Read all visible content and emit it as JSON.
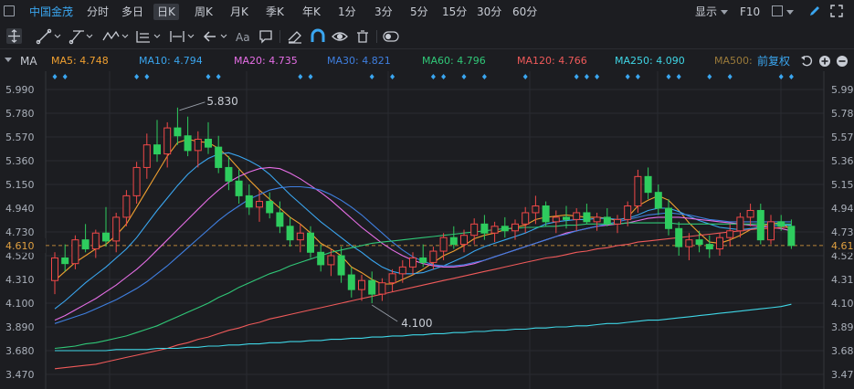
{
  "toolbar": {
    "stock_name": "中国金茂",
    "periods": [
      "分时",
      "多日",
      "日K",
      "周K",
      "月K",
      "季K",
      "年K",
      "1分",
      "3分",
      "5分",
      "15分",
      "30分",
      "60分"
    ],
    "selected_period": "日K",
    "display_label": "显示",
    "f10_label": "F10"
  },
  "drawing_tools": {
    "icons": [
      "crosshair-icon",
      "line-tool-icon",
      "channel-tool-icon",
      "wave-tool-icon",
      "fib-tool-icon",
      "measure-tool-icon",
      "arrow-tool-icon",
      "text-tool-icon",
      "note-icon",
      "eraser-icon",
      "magnet-icon",
      "eye-icon",
      "trash-icon",
      "toggle-icon"
    ]
  },
  "indicators": {
    "main_label": "MA",
    "items": [
      {
        "label": "MA5: 4.748",
        "color": "#f0a030"
      },
      {
        "label": "MA10: 4.794",
        "color": "#3aa6f0"
      },
      {
        "label": "MA20: 4.735",
        "color": "#e66ee6"
      },
      {
        "label": "MA30: 4.821",
        "color": "#3f7fe0"
      },
      {
        "label": "MA60: 4.796",
        "color": "#30c878"
      },
      {
        "label": "MA120: 4.766",
        "color": "#f05a5a"
      },
      {
        "label": "MA250: 4.090",
        "color": "#3fd6e6"
      },
      {
        "label": "MA500:",
        "color": "#9a7a3a"
      }
    ],
    "adjust_label": "前复权"
  },
  "chart_data": {
    "type": "candlestick",
    "y_ticks": [
      "5.990",
      "5.780",
      "5.570",
      "5.360",
      "5.150",
      "4.940",
      "4.730",
      "4.520",
      "4.310",
      "4.100",
      "3.890",
      "3.680",
      "3.470"
    ],
    "ylim": [
      3.47,
      5.99
    ],
    "current_price": "4.610",
    "annotations": {
      "high": "5.830",
      "low": "4.100"
    },
    "up_color": "#f04848",
    "down_color": "#2ecc5e",
    "candles": [
      [
        4.3,
        4.55,
        4.18,
        4.5
      ],
      [
        4.5,
        4.62,
        4.38,
        4.45
      ],
      [
        4.45,
        4.7,
        4.4,
        4.66
      ],
      [
        4.66,
        4.8,
        4.55,
        4.58
      ],
      [
        4.58,
        4.75,
        4.5,
        4.72
      ],
      [
        4.72,
        4.95,
        4.6,
        4.65
      ],
      [
        4.65,
        4.9,
        4.55,
        4.86
      ],
      [
        4.86,
        5.1,
        4.78,
        5.05
      ],
      [
        5.05,
        5.35,
        4.98,
        5.3
      ],
      [
        5.3,
        5.6,
        5.2,
        5.5
      ],
      [
        5.5,
        5.72,
        5.35,
        5.42
      ],
      [
        5.42,
        5.7,
        5.3,
        5.65
      ],
      [
        5.65,
        5.83,
        5.5,
        5.58
      ],
      [
        5.58,
        5.75,
        5.4,
        5.45
      ],
      [
        5.45,
        5.62,
        5.3,
        5.55
      ],
      [
        5.55,
        5.7,
        5.42,
        5.48
      ],
      [
        5.48,
        5.58,
        5.25,
        5.3
      ],
      [
        5.3,
        5.4,
        5.1,
        5.18
      ],
      [
        5.18,
        5.28,
        4.98,
        5.05
      ],
      [
        5.05,
        5.15,
        4.88,
        4.95
      ],
      [
        4.95,
        5.1,
        4.82,
        5.0
      ],
      [
        5.0,
        5.08,
        4.85,
        4.9
      ],
      [
        4.9,
        5.0,
        4.72,
        4.78
      ],
      [
        4.78,
        4.86,
        4.6,
        4.66
      ],
      [
        4.66,
        4.8,
        4.55,
        4.72
      ],
      [
        4.72,
        4.78,
        4.5,
        4.55
      ],
      [
        4.55,
        4.62,
        4.38,
        4.44
      ],
      [
        4.44,
        4.58,
        4.34,
        4.52
      ],
      [
        4.52,
        4.6,
        4.28,
        4.35
      ],
      [
        4.35,
        4.42,
        4.15,
        4.22
      ],
      [
        4.22,
        4.35,
        4.12,
        4.3
      ],
      [
        4.3,
        4.38,
        4.1,
        4.18
      ],
      [
        4.18,
        4.32,
        4.12,
        4.28
      ],
      [
        4.28,
        4.4,
        4.2,
        4.36
      ],
      [
        4.36,
        4.48,
        4.28,
        4.42
      ],
      [
        4.42,
        4.55,
        4.35,
        4.5
      ],
      [
        4.5,
        4.62,
        4.42,
        4.46
      ],
      [
        4.46,
        4.6,
        4.4,
        4.56
      ],
      [
        4.56,
        4.72,
        4.48,
        4.68
      ],
      [
        4.68,
        4.78,
        4.58,
        4.62
      ],
      [
        4.62,
        4.75,
        4.55,
        4.7
      ],
      [
        4.7,
        4.85,
        4.62,
        4.8
      ],
      [
        4.8,
        4.88,
        4.66,
        4.72
      ],
      [
        4.72,
        4.82,
        4.64,
        4.78
      ],
      [
        4.78,
        4.86,
        4.68,
        4.74
      ],
      [
        4.74,
        4.84,
        4.66,
        4.8
      ],
      [
        4.8,
        4.95,
        4.72,
        4.9
      ],
      [
        4.9,
        5.05,
        4.8,
        4.96
      ],
      [
        4.96,
        5.0,
        4.78,
        4.82
      ],
      [
        4.82,
        4.92,
        4.72,
        4.86
      ],
      [
        4.86,
        4.96,
        4.76,
        4.84
      ],
      [
        4.84,
        4.94,
        4.74,
        4.9
      ],
      [
        4.9,
        4.98,
        4.8,
        4.82
      ],
      [
        4.82,
        4.9,
        4.74,
        4.86
      ],
      [
        4.86,
        4.94,
        4.78,
        4.8
      ],
      [
        4.8,
        4.88,
        4.72,
        4.84
      ],
      [
        4.84,
        5.0,
        4.78,
        4.96
      ],
      [
        4.96,
        5.28,
        4.9,
        5.22
      ],
      [
        5.22,
        5.3,
        5.02,
        5.08
      ],
      [
        5.08,
        5.15,
        4.88,
        4.94
      ],
      [
        4.94,
        5.02,
        4.7,
        4.76
      ],
      [
        4.76,
        4.82,
        4.52,
        4.6
      ],
      [
        4.6,
        4.72,
        4.48,
        4.66
      ],
      [
        4.66,
        4.74,
        4.55,
        4.62
      ],
      [
        4.62,
        4.7,
        4.5,
        4.58
      ],
      [
        4.58,
        4.72,
        4.52,
        4.68
      ],
      [
        4.68,
        4.8,
        4.6,
        4.74
      ],
      [
        4.74,
        4.9,
        4.68,
        4.86
      ],
      [
        4.86,
        4.98,
        4.78,
        4.92
      ],
      [
        4.92,
        4.98,
        4.62,
        4.66
      ],
      [
        4.66,
        4.88,
        4.62,
        4.82
      ],
      [
        4.82,
        4.88,
        4.74,
        4.78
      ],
      [
        4.78,
        4.84,
        4.58,
        4.61
      ]
    ],
    "ma": {
      "MA5": [
        4.3,
        4.38,
        4.46,
        4.52,
        4.58,
        4.62,
        4.7,
        4.8,
        4.95,
        5.1,
        5.25,
        5.4,
        5.52,
        5.55,
        5.53,
        5.52,
        5.47,
        5.39,
        5.29,
        5.19,
        5.1,
        5.02,
        4.94,
        4.86,
        4.8,
        4.72,
        4.63,
        4.58,
        4.52,
        4.42,
        4.37,
        4.31,
        4.27,
        4.27,
        4.31,
        4.35,
        4.4,
        4.46,
        4.52,
        4.56,
        4.61,
        4.67,
        4.7,
        4.72,
        4.75,
        4.77,
        4.79,
        4.84,
        4.86,
        4.87,
        4.88,
        4.87,
        4.86,
        4.86,
        4.85,
        4.83,
        4.86,
        4.96,
        5.01,
        5.05,
        5.01,
        4.92,
        4.81,
        4.72,
        4.64,
        4.63,
        4.66,
        4.7,
        4.75,
        4.78,
        4.8,
        4.81,
        4.75
      ],
      "MA10": [
        4.05,
        4.12,
        4.2,
        4.28,
        4.35,
        4.42,
        4.5,
        4.58,
        4.68,
        4.8,
        4.92,
        5.03,
        5.14,
        5.24,
        5.32,
        5.38,
        5.42,
        5.43,
        5.4,
        5.36,
        5.31,
        5.24,
        5.15,
        5.06,
        4.98,
        4.9,
        4.82,
        4.75,
        4.68,
        4.61,
        4.55,
        4.48,
        4.42,
        4.38,
        4.36,
        4.36,
        4.37,
        4.4,
        4.43,
        4.47,
        4.51,
        4.56,
        4.6,
        4.63,
        4.66,
        4.69,
        4.72,
        4.76,
        4.8,
        4.82,
        4.83,
        4.84,
        4.84,
        4.85,
        4.85,
        4.84,
        4.85,
        4.88,
        4.92,
        4.94,
        4.94,
        4.91,
        4.87,
        4.83,
        4.8,
        4.77,
        4.76,
        4.75,
        4.76,
        4.77,
        4.78,
        4.79,
        4.79
      ],
      "MA20": [
        3.95,
        3.99,
        4.04,
        4.09,
        4.14,
        4.2,
        4.26,
        4.33,
        4.4,
        4.48,
        4.57,
        4.66,
        4.75,
        4.84,
        4.93,
        5.02,
        5.1,
        5.17,
        5.22,
        5.26,
        5.29,
        5.3,
        5.29,
        5.25,
        5.2,
        5.14,
        5.08,
        5.01,
        4.93,
        4.85,
        4.77,
        4.7,
        4.63,
        4.57,
        4.52,
        4.48,
        4.45,
        4.43,
        4.42,
        4.42,
        4.43,
        4.45,
        4.48,
        4.51,
        4.54,
        4.57,
        4.6,
        4.63,
        4.66,
        4.69,
        4.72,
        4.74,
        4.76,
        4.78,
        4.79,
        4.8,
        4.81,
        4.83,
        4.85,
        4.86,
        4.86,
        4.86,
        4.85,
        4.84,
        4.83,
        4.82,
        4.81,
        4.8,
        4.79,
        4.78,
        4.77,
        4.76,
        4.74
      ],
      "MA30": [
        3.92,
        3.95,
        3.98,
        4.01,
        4.05,
        4.09,
        4.13,
        4.18,
        4.23,
        4.29,
        4.36,
        4.43,
        4.51,
        4.59,
        4.67,
        4.75,
        4.83,
        4.9,
        4.96,
        5.02,
        5.06,
        5.1,
        5.12,
        5.13,
        5.13,
        5.12,
        5.1,
        5.06,
        5.01,
        4.95,
        4.88,
        4.8,
        4.72,
        4.64,
        4.57,
        4.51,
        4.47,
        4.44,
        4.43,
        4.43,
        4.44,
        4.46,
        4.48,
        4.51,
        4.54,
        4.57,
        4.6,
        4.63,
        4.66,
        4.69,
        4.71,
        4.74,
        4.76,
        4.78,
        4.8,
        4.82,
        4.84,
        4.86,
        4.88,
        4.89,
        4.9,
        4.89,
        4.88,
        4.86,
        4.84,
        4.83,
        4.82,
        4.82,
        4.82,
        4.82,
        4.82,
        4.82,
        4.82
      ],
      "MA60": [
        3.7,
        3.71,
        3.72,
        3.74,
        3.75,
        3.77,
        3.79,
        3.81,
        3.84,
        3.87,
        3.9,
        3.94,
        3.98,
        4.02,
        4.06,
        4.1,
        4.15,
        4.19,
        4.24,
        4.28,
        4.32,
        4.36,
        4.39,
        4.43,
        4.46,
        4.49,
        4.52,
        4.55,
        4.57,
        4.59,
        4.61,
        4.63,
        4.64,
        4.65,
        4.66,
        4.67,
        4.68,
        4.69,
        4.7,
        4.71,
        4.72,
        4.73,
        4.74,
        4.75,
        4.76,
        4.76,
        4.77,
        4.77,
        4.78,
        4.78,
        4.79,
        4.79,
        4.8,
        4.8,
        4.8,
        4.8,
        4.81,
        4.81,
        4.81,
        4.81,
        4.81,
        4.8,
        4.8,
        4.8,
        4.8,
        4.8,
        4.8,
        4.8,
        4.8,
        4.8,
        4.8,
        4.8,
        4.8
      ],
      "MA120": [
        3.52,
        3.53,
        3.54,
        3.55,
        3.56,
        3.58,
        3.6,
        3.62,
        3.64,
        3.66,
        3.68,
        3.7,
        3.73,
        3.75,
        3.78,
        3.8,
        3.83,
        3.86,
        3.88,
        3.91,
        3.93,
        3.96,
        3.98,
        4.0,
        4.02,
        4.04,
        4.06,
        4.08,
        4.1,
        4.12,
        4.14,
        4.16,
        4.18,
        4.2,
        4.22,
        4.24,
        4.26,
        4.28,
        4.3,
        4.32,
        4.34,
        4.36,
        4.38,
        4.4,
        4.42,
        4.44,
        4.46,
        4.48,
        4.5,
        4.51,
        4.53,
        4.55,
        4.56,
        4.58,
        4.59,
        4.61,
        4.62,
        4.64,
        4.65,
        4.66,
        4.67,
        4.68,
        4.69,
        4.7,
        4.71,
        4.72,
        4.73,
        4.74,
        4.75,
        4.76,
        4.76,
        4.77,
        4.77
      ],
      "MA250": [
        3.68,
        3.68,
        3.68,
        3.68,
        3.68,
        3.68,
        3.69,
        3.69,
        3.69,
        3.69,
        3.7,
        3.7,
        3.7,
        3.71,
        3.71,
        3.72,
        3.72,
        3.73,
        3.73,
        3.74,
        3.74,
        3.75,
        3.75,
        3.76,
        3.76,
        3.77,
        3.77,
        3.78,
        3.78,
        3.79,
        3.79,
        3.8,
        3.8,
        3.81,
        3.81,
        3.82,
        3.82,
        3.83,
        3.83,
        3.84,
        3.84,
        3.85,
        3.85,
        3.86,
        3.86,
        3.87,
        3.87,
        3.88,
        3.88,
        3.89,
        3.89,
        3.9,
        3.9,
        3.91,
        3.92,
        3.92,
        3.93,
        3.94,
        3.95,
        3.95,
        3.96,
        3.97,
        3.98,
        3.99,
        4.0,
        4.01,
        4.02,
        4.03,
        4.04,
        4.05,
        4.06,
        4.07,
        4.09
      ]
    }
  }
}
